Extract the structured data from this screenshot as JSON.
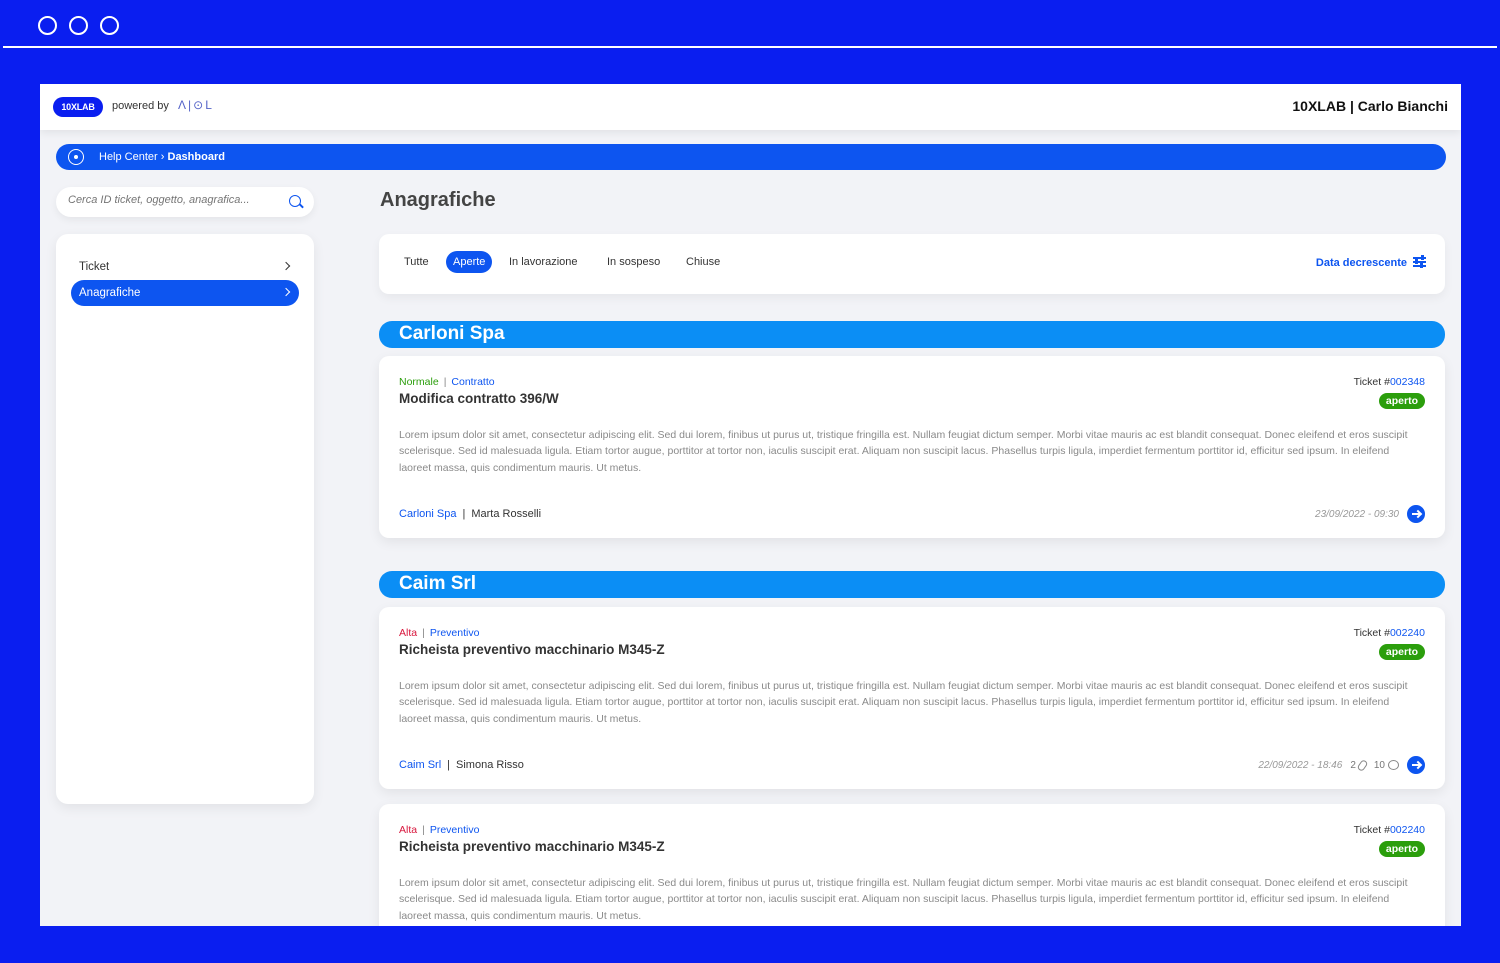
{
  "header": {
    "brand": "10XLAB",
    "powered_by": "powered by",
    "partner_logo": "Λ|⊙L",
    "user": "10XLAB | Carlo Bianchi"
  },
  "breadcrumb": {
    "root": "Help Center",
    "current": "Dashboard"
  },
  "search": {
    "placeholder": "Cerca ID ticket, oggetto, anagrafica..."
  },
  "sidebar": {
    "items": [
      {
        "label": "Ticket"
      },
      {
        "label": "Anagrafiche"
      }
    ]
  },
  "main": {
    "title": "Anagrafiche",
    "filters": [
      "Tutte",
      "Aperte",
      "In lavorazione",
      "In sospeso",
      "Chiuse"
    ],
    "active_filter": "Aperte",
    "sort_label": "Data decrescente"
  },
  "groups": [
    {
      "name": "Carloni Spa",
      "tickets": [
        {
          "priority": "Normale",
          "category": "Contratto",
          "title": "Modifica contratto 396/W",
          "ticket_prefix": "Ticket #",
          "ticket_no": "002348",
          "status": "aperto",
          "description": "Lorem ipsum dolor sit amet, consectetur adipiscing elit. Sed dui lorem, finibus ut purus ut, tristique fringilla est. Nullam feugiat dictum semper. Morbi vitae mauris ac est blandit consequat. Donec eleifend et eros suscipit scelerisque. Sed id malesuada ligula. Etiam tortor augue, porttitor at tortor non, iaculis suscipit erat. Aliquam non suscipit lacus. Phasellus turpis ligula, imperdiet fermentum porttitor id, efficitur sed ipsum. In eleifend laoreet massa, quis condimentum mauris. Ut metus.",
          "company": "Carloni Spa",
          "person": "Marta Rosselli",
          "datetime": "23/09/2022 - 09:30"
        }
      ]
    },
    {
      "name": "Caim Srl",
      "tickets": [
        {
          "priority": "Alta",
          "category": "Preventivo",
          "title": "Richeista preventivo macchinario M345-Z",
          "ticket_prefix": "Ticket #",
          "ticket_no": "002240",
          "status": "aperto",
          "description": "Lorem ipsum dolor sit amet, consectetur adipiscing elit. Sed dui lorem, finibus ut purus ut, tristique fringilla est. Nullam feugiat dictum semper. Morbi vitae mauris ac est blandit consequat. Donec eleifend et eros suscipit scelerisque. Sed id malesuada ligula. Etiam tortor augue, porttitor at tortor non, iaculis suscipit erat. Aliquam non suscipit lacus. Phasellus turpis ligula, imperdiet fermentum porttitor id, efficitur sed ipsum. In eleifend laoreet massa, quis condimentum mauris. Ut metus.",
          "company": "Caim Srl",
          "person": "Simona Risso",
          "datetime": "22/09/2022 - 18:46",
          "attachments": "2",
          "comments": "10"
        },
        {
          "priority": "Alta",
          "category": "Preventivo",
          "title": "Richeista preventivo macchinario M345-Z",
          "ticket_prefix": "Ticket #",
          "ticket_no": "002240",
          "status": "aperto",
          "description": "Lorem ipsum dolor sit amet, consectetur adipiscing elit. Sed dui lorem, finibus ut purus ut, tristique fringilla est. Nullam feugiat dictum semper. Morbi vitae mauris ac est blandit consequat. Donec eleifend et eros suscipit scelerisque. Sed id malesuada ligula. Etiam tortor augue, porttitor at tortor non, iaculis suscipit erat. Aliquam non suscipit lacus. Phasellus turpis ligula, imperdiet fermentum porttitor id, efficitur sed ipsum. In eleifend laoreet massa, quis condimentum mauris. Ut metus."
        }
      ]
    }
  ],
  "colors": {
    "background": "#0a1ef0",
    "primary": "#0d55f0",
    "group_header": "#0b8ef5",
    "status_open": "#2b9e0c",
    "priority_normal": "#2b9e0c",
    "priority_high": "#d8163c"
  },
  "icons": [
    "search-icon",
    "chevron-right-icon",
    "sort-icon",
    "paperclip-icon",
    "comment-icon",
    "arrow-right-circle-icon",
    "target-icon"
  ]
}
